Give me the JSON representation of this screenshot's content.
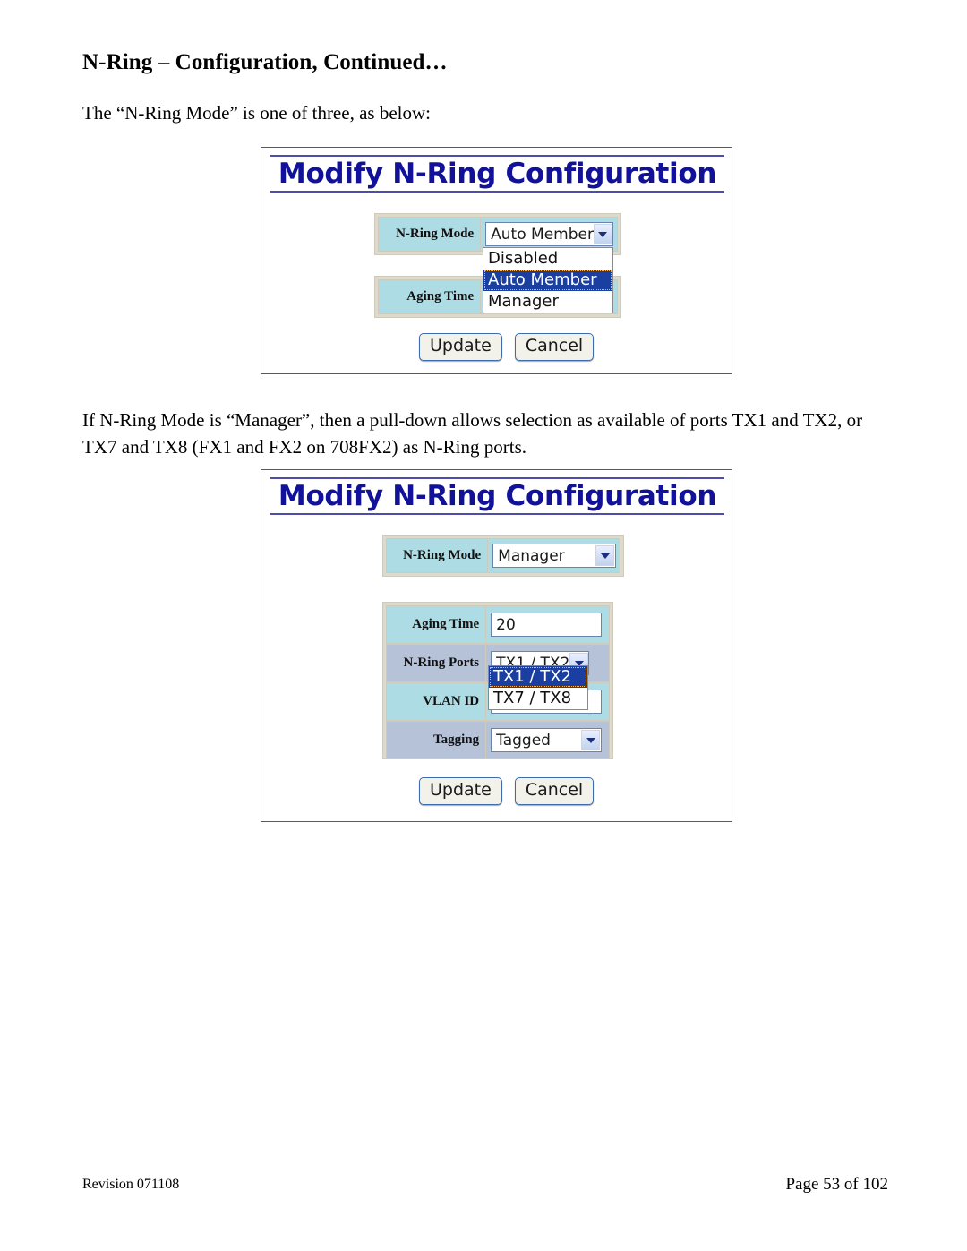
{
  "document": {
    "heading": "N-Ring – Configuration, Continued…",
    "paragraph_1": "The “N-Ring Mode” is one of three, as below:",
    "paragraph_2": "If N-Ring Mode is “Manager”, then a pull-down allows selection as available of ports TX1 and TX2, or TX7 and TX8 (FX1 and FX2 on 708FX2) as N-Ring ports.",
    "footer_left": "Revision 071108",
    "footer_right": "Page 53 of 102"
  },
  "colors": {
    "title_navy": "#11119a",
    "label_cell_blue": "#aedce4",
    "label_cell_alt": "#b6c2d7",
    "table_frame": "#dedacb",
    "select_highlight": "#1b3fa0",
    "button_border": "#3f6ba8"
  },
  "screenshot_1": {
    "title": "Modify N-Ring Configuration",
    "fields": [
      {
        "label": "N-Ring Mode",
        "value": "Auto Member",
        "type": "select"
      },
      {
        "label": "Aging Time",
        "value": "",
        "type": "text"
      }
    ],
    "open_dropdown": {
      "belongs_to": "N-Ring Mode",
      "options": [
        "Disabled",
        "Auto Member",
        "Manager"
      ],
      "selected": "Auto Member"
    },
    "buttons": [
      {
        "label": "Update"
      },
      {
        "label": "Cancel"
      }
    ]
  },
  "screenshot_2": {
    "title": "Modify N-Ring Configuration",
    "mode_field": {
      "label": "N-Ring Mode",
      "value": "Manager",
      "type": "select"
    },
    "fields": [
      {
        "label": "Aging Time",
        "value": "20",
        "type": "text"
      },
      {
        "label": "N-Ring Ports",
        "value": "TX1 / TX2",
        "type": "select"
      },
      {
        "label": "VLAN ID",
        "value": "",
        "type": "text"
      },
      {
        "label": "Tagging",
        "value": "Tagged",
        "type": "select"
      }
    ],
    "open_dropdown": {
      "belongs_to": "N-Ring Ports",
      "options": [
        "TX1 / TX2",
        "TX7 / TX8"
      ],
      "selected": "TX1 / TX2"
    },
    "buttons": [
      {
        "label": "Update"
      },
      {
        "label": "Cancel"
      }
    ]
  }
}
